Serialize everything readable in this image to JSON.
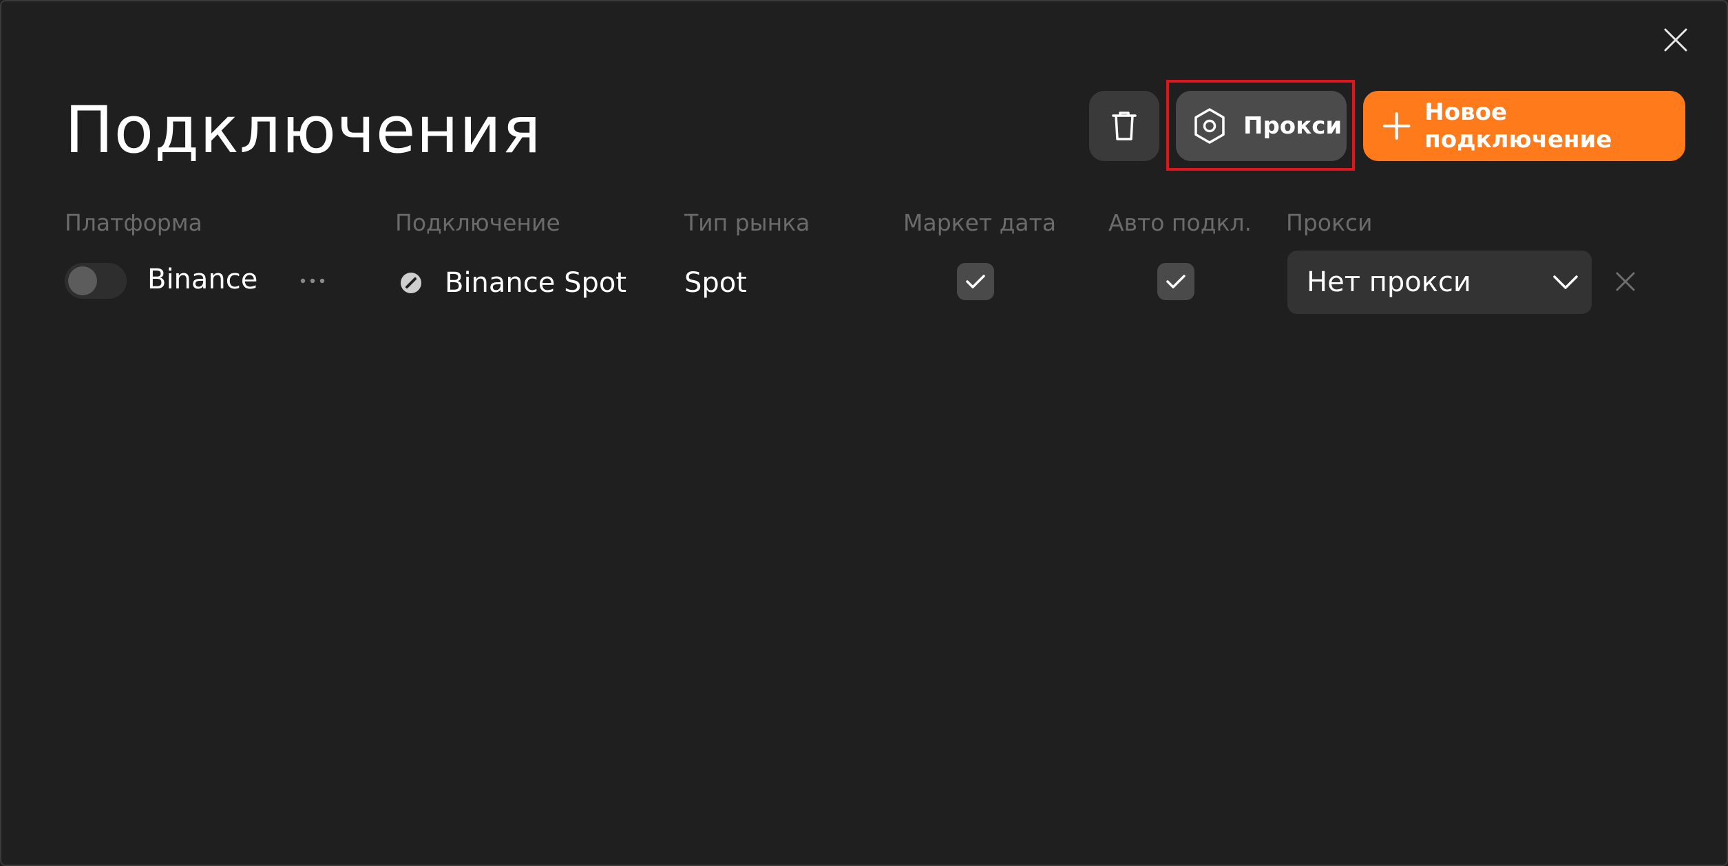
{
  "page": {
    "title": "Подключения"
  },
  "toolbar": {
    "delete_icon": "trash-icon",
    "proxy_label": "Прокси",
    "proxy_icon": "hexagon-settings-icon",
    "new_connection_label": "Новое подключение",
    "new_connection_icon": "plus-icon",
    "accent_color": "#ff7a1a",
    "highlight_color": "#e0141b"
  },
  "table": {
    "headers": {
      "platform": "Платформа",
      "connection": "Подключение",
      "market_type": "Тип рынка",
      "market_data": "Маркет дата",
      "auto_connect": "Авто подкл.",
      "proxy": "Прокси"
    },
    "rows": [
      {
        "enabled": false,
        "platform": "Binance",
        "connection": "Binance Spot",
        "market_type": "Spot",
        "market_data": true,
        "auto_connect": true,
        "proxy": "Нет прокси"
      }
    ]
  }
}
